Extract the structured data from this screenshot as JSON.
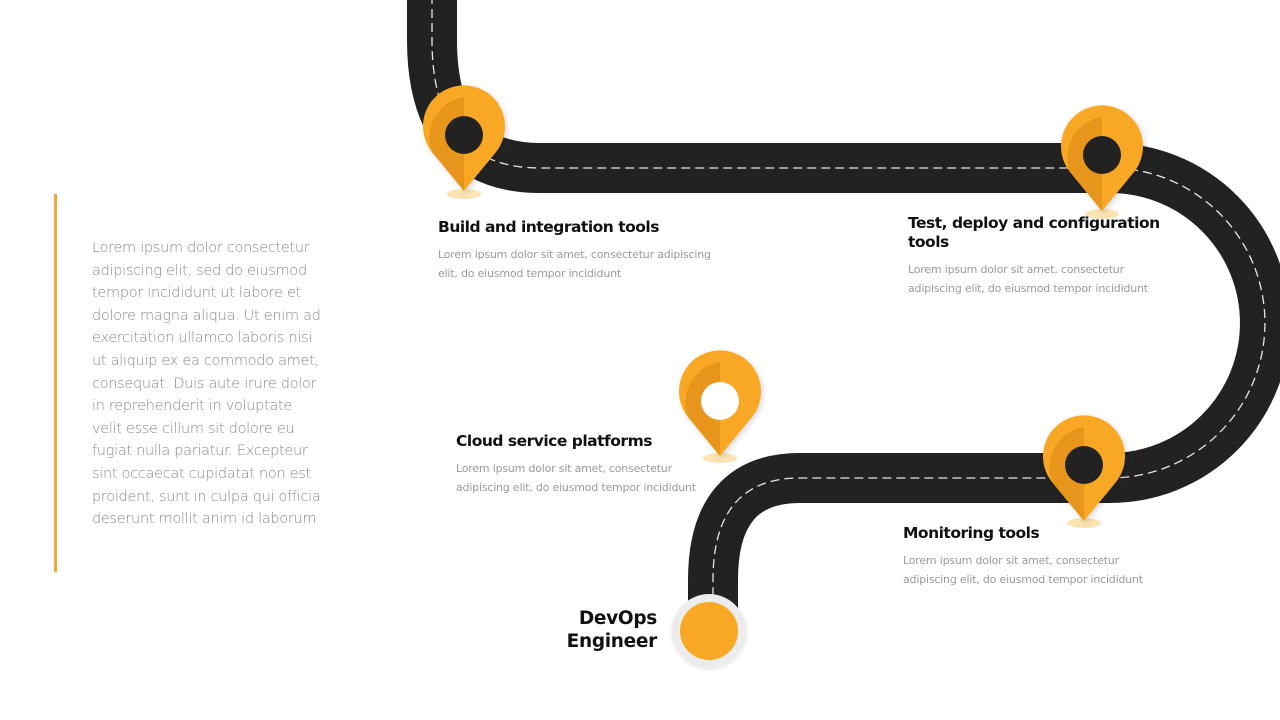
{
  "intro": {
    "text": "Lorem ipsum dolor consectetur adipiscing elit, sed do eiusmod tempor incididunt ut labore et dolore magna aliqua. Ut enim ad exercitation ullamco laboris nisi ut aliquip ex ea commodo amet, consequat. Duis aute irure dolor in reprehenderit in voluptate velit esse cillum sit  dolore eu fugiat nulla pariatur. Excepteur sint occaecat cupidatat non est proident, sunt in culpa qui officia deserunt mollit anim id laborum"
  },
  "colors": {
    "accent": "#f9a825",
    "accent_dark": "#e8951a",
    "road": "#222222",
    "road_marking": "#e6e6e6"
  },
  "steps": [
    {
      "title": "Build and integration tools",
      "description": "Lorem ipsum dolor  sit amet, consectetur adipiscing elit, do eiusmod tempor incididunt",
      "icon": "map-pin-icon"
    },
    {
      "title": "Test, deploy and configuration tools",
      "description": "Lorem ipsum dolor  sit amet, consectetur adipiscing elit, do eiusmod tempor incididunt",
      "icon": "map-pin-icon"
    },
    {
      "title": "Cloud service platforms",
      "description": "Lorem ipsum dolor  sit amet, consectetur adipiscing elit, do eiusmod tempor incididunt",
      "icon": "map-pin-icon"
    },
    {
      "title": "Monitoring tools",
      "description": "Lorem ipsum dolor  sit amet, consectetur adipiscing elit, do eiusmod tempor incididunt",
      "icon": "map-pin-icon"
    }
  ],
  "endpoint": {
    "label_line1": "DevOps",
    "label_line2": "Engineer"
  }
}
